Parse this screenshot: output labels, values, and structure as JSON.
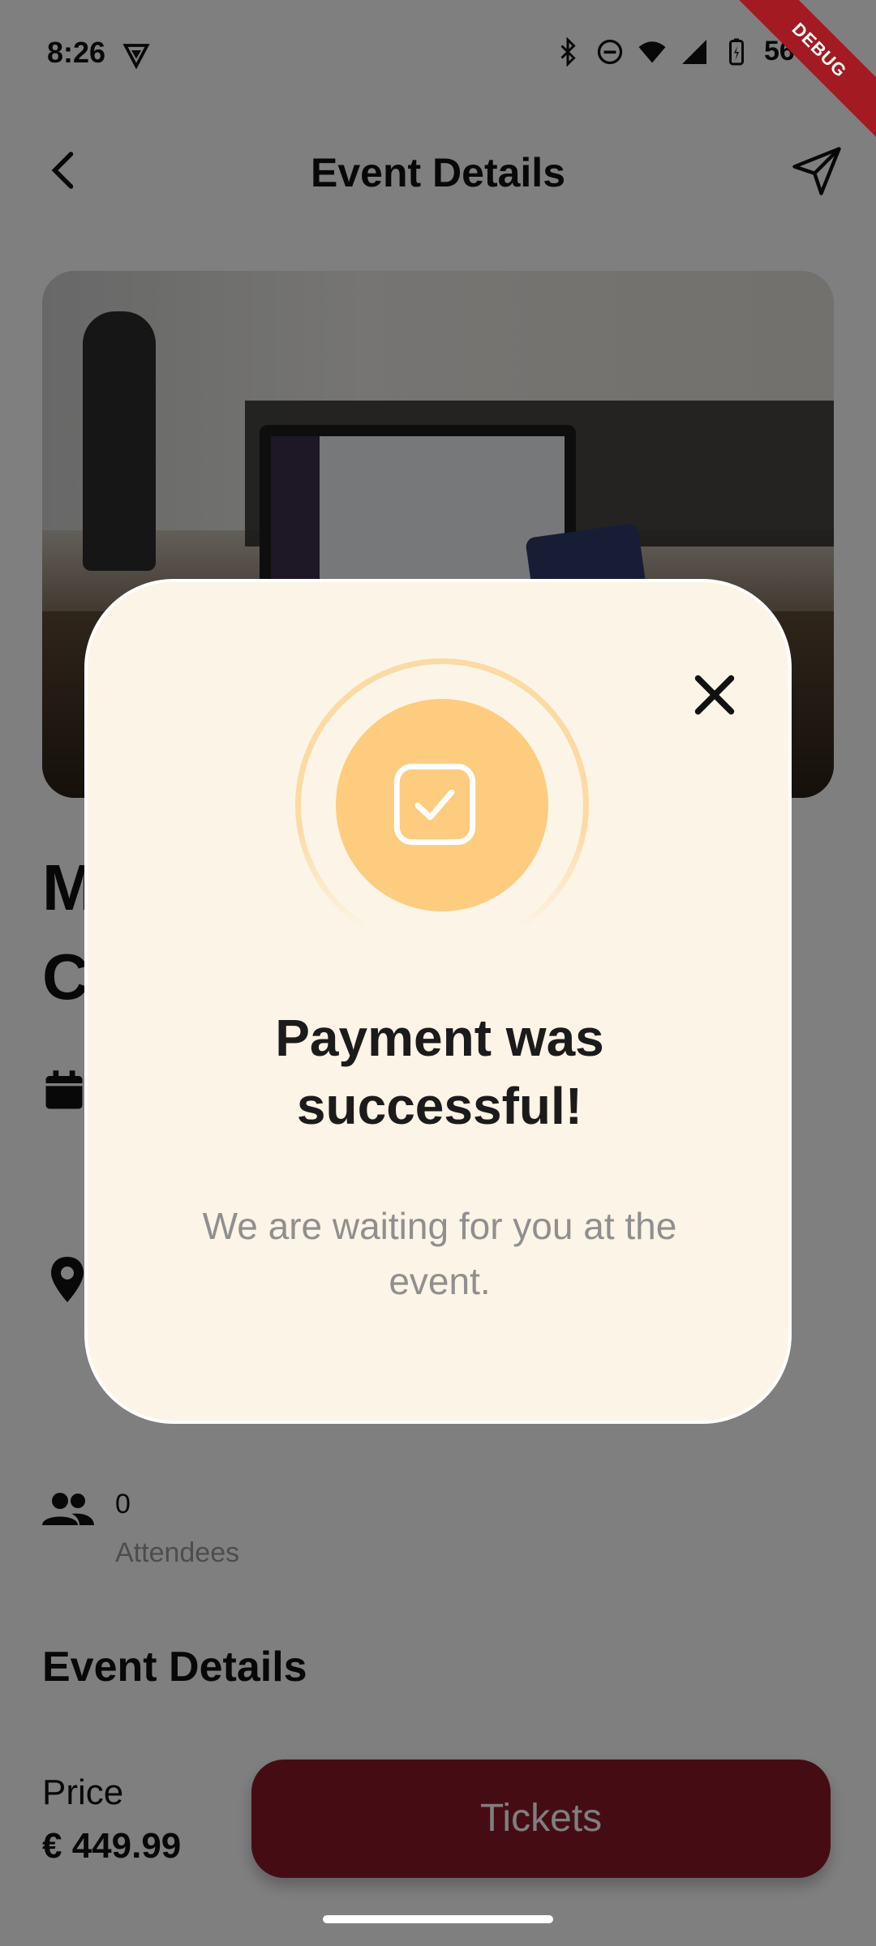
{
  "status_bar": {
    "time": "8:26",
    "battery": "56%",
    "debug_label": "DEBUG"
  },
  "app_bar": {
    "title": "Event Details"
  },
  "event": {
    "title_partial_line1": "M",
    "title_partial_line2": "C",
    "attendees_count": "0",
    "attendees_label": "Attendees",
    "section_title": "Event Details",
    "price_label": "Price",
    "price_value": "€ 449.99",
    "tickets_label": "Tickets"
  },
  "dialog": {
    "title_line1": "Payment was",
    "title_line2": "successful!",
    "message": "We are waiting for you at the event."
  },
  "colors": {
    "accent_orange": "#fecc7e",
    "dialog_bg": "#fcf4e6",
    "tickets_button": "#8b1a26",
    "debug_ribbon": "#a31a22"
  },
  "icons": [
    "vpn-icon",
    "bluetooth-icon",
    "dnd-icon",
    "wifi-icon",
    "signal-icon",
    "battery-icon",
    "back-arrow-icon",
    "send-icon",
    "calendar-icon",
    "location-pin-icon",
    "people-icon",
    "close-icon",
    "check-icon"
  ]
}
